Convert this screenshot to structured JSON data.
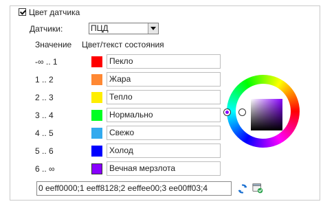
{
  "sensor_color": {
    "checkbox_label": "Цвет датчика",
    "checked": true
  },
  "sensors": {
    "label": "Датчики:",
    "selected": "ПЦД"
  },
  "table": {
    "header_value": "Значение",
    "header_color": "Цвет/текст состояния",
    "rows": [
      {
        "range": "-∞ .. 1",
        "color": "#ff0000",
        "text": "Пекло"
      },
      {
        "range": "1 .. 2",
        "color": "#ff8833",
        "text": "Жара"
      },
      {
        "range": "2 .. 3",
        "color": "#ffee00",
        "text": "Тепло"
      },
      {
        "range": "3 .. 4",
        "color": "#00ff22",
        "text": "Нормально"
      },
      {
        "range": "4 .. 5",
        "color": "#33aaee",
        "text": "Свежо"
      },
      {
        "range": "5 .. 6",
        "color": "#0000ff",
        "text": "Холод"
      },
      {
        "range": "6 .. ∞",
        "color": "#8800ff",
        "text": "Вечная мерзлота"
      }
    ]
  },
  "code_string": "0 eeff0000;1 eeff8128;2 eeffee00;3 ee00ff03;4",
  "icons": {
    "refresh": "refresh-icon",
    "apply": "apply-icon"
  }
}
